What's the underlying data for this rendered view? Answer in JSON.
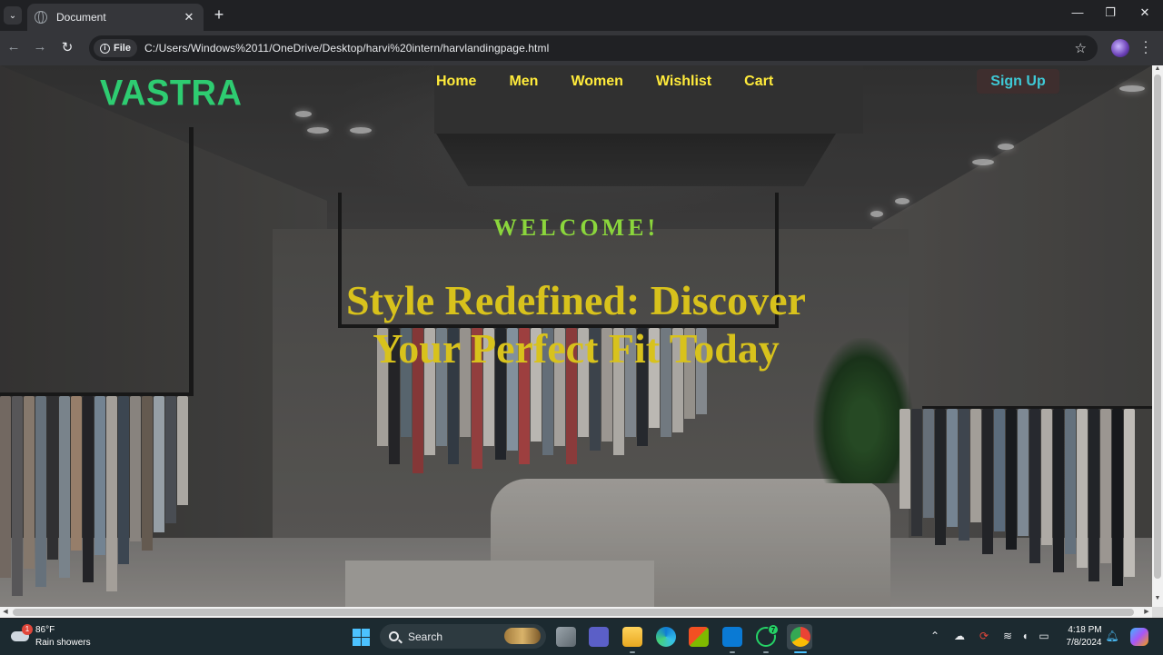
{
  "browser": {
    "tab_title": "Document",
    "url_chip": "File",
    "url": "C:/Users/Windows%2011/OneDrive/Desktop/harvi%20intern/harvlandingpage.html",
    "icons": {
      "tab_search": "chevron-down-icon",
      "favicon": "globe-icon",
      "close_tab": "close-icon",
      "new_tab": "plus-icon",
      "back": "arrow-left-icon",
      "forward": "arrow-right-icon",
      "reload": "reload-icon",
      "info": "info-icon",
      "bookmark": "star-icon",
      "menu": "kebab-menu-icon"
    }
  },
  "page": {
    "logo": "VASTRA",
    "nav": {
      "home": "Home",
      "men": "Men",
      "women": "Women",
      "wishlist": "Wishlist",
      "cart": "Cart"
    },
    "signup": "Sign Up",
    "welcome": "WELCOME!",
    "headline": "Style Redefined: Discover Your Perfect Fit Today",
    "colors": {
      "logo": "#2ecc71",
      "nav": "#ffeb3b",
      "signup_text": "#3ec9d6",
      "signup_bg": "#3e2e2e",
      "welcome": "#8bd63c",
      "headline": "#d8c21c"
    }
  },
  "taskbar": {
    "weather_temp": "86°F",
    "weather_desc": "Rain showers",
    "weather_badge": "1",
    "search_label": "Search",
    "whatsapp_badge": "7",
    "time": "4:18 PM",
    "date": "7/8/2024"
  }
}
